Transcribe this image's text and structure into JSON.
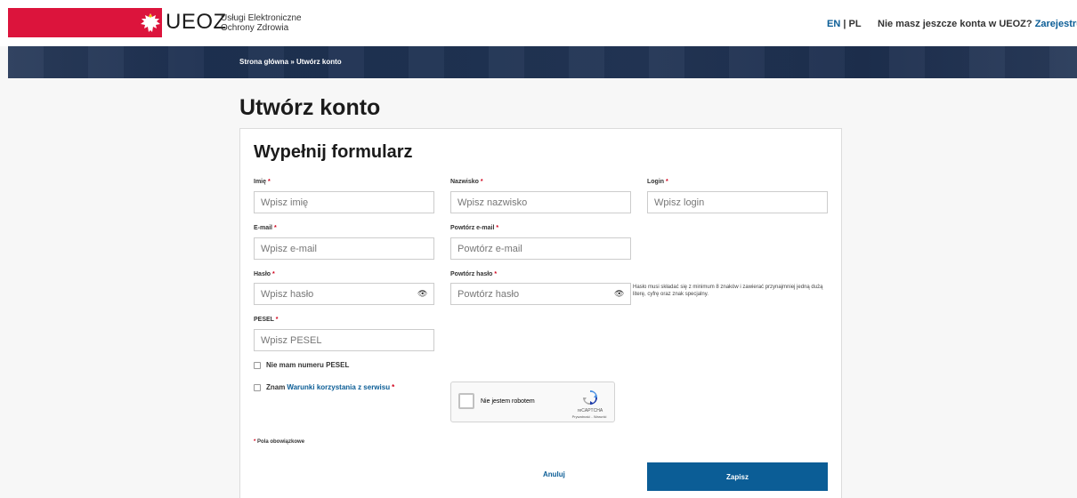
{
  "header": {
    "logo_text": "UEOZ",
    "logo_subtitle_line1": "Usługi Elektroniczne",
    "logo_subtitle_line2": "Ochrony Zdrowia",
    "lang_en": "EN",
    "lang_sep": "|",
    "lang_pl": "PL",
    "account_question": "Nie masz jeszcze konta w UEOZ?",
    "register_link": "Zarejestruj się",
    "brand_color": "#dc143c",
    "link_color": "#0b5d96"
  },
  "breadcrumb": "Strona główna » Utwórz konto",
  "page_title": "Utwórz konto",
  "form": {
    "title": "Wypełnij formularz",
    "fields": {
      "first_name": {
        "label": "Imię",
        "placeholder": "Wpisz imię"
      },
      "last_name": {
        "label": "Nazwisko",
        "placeholder": "Wpisz nazwisko"
      },
      "login": {
        "label": "Login",
        "placeholder": "Wpisz login"
      },
      "email": {
        "label": "E-mail",
        "placeholder": "Wpisz e-mail"
      },
      "email_repeat": {
        "label": "Powtórz e-mail",
        "placeholder": "Powtórz e-mail"
      },
      "password": {
        "label": "Hasło",
        "placeholder": "Wpisz hasło"
      },
      "password_repeat": {
        "label": "Powtórz hasło",
        "placeholder": "Powtórz hasło"
      },
      "pesel": {
        "label": "PESEL",
        "placeholder": "Wpisz PESEL"
      }
    },
    "required_mark": "*",
    "password_hint": "Hasło musi składać się z minimum 8 znaków i zawierać przynajmniej jedną dużą literę, cyfrę oraz znak specjalny.",
    "no_pesel_label": "Nie mam numeru PESEL",
    "terms_prefix": "Znam",
    "terms_link": "Warunki korzystania z serwisu",
    "recaptcha": {
      "label": "Nie jestem robotem",
      "brand": "reCAPTCHA",
      "links": "Prywatność - Warunki"
    },
    "required_note": "Pola obowiązkowe",
    "cancel_label": "Anuluj",
    "save_label": "Zapisz"
  }
}
